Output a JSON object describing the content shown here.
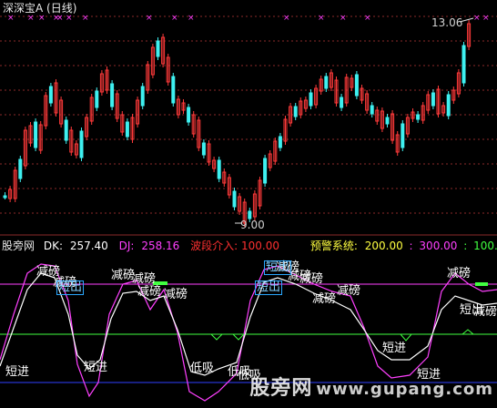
{
  "window": {
    "title": "深深宝A (日线)"
  },
  "main_chart": {
    "high_label": "13.06",
    "low_label": "9.00",
    "colors": {
      "up": "#ff3a3a",
      "down": "#3ef0f0",
      "grid": "#8b2a2a",
      "marker": "#ff40ff"
    }
  },
  "indicator": {
    "name": "股旁网",
    "dk_label": "DK:",
    "dk_value": "257.40",
    "dj_label": "DJ:",
    "dj_value": "258.16",
    "wave_label": "波段介入:",
    "wave_value": "100.00",
    "warn_label": "预警系统:",
    "warn_v1": "200.00",
    "sep": ":",
    "warn_v2": "300.00",
    "warn_v3": "100.00",
    "colors": {
      "name": "#e8e8e8",
      "dk": "#ffffff",
      "dj": "#ff40ff",
      "wave": "#ff3030",
      "warn": "#ffff40",
      "v1": "#ffff40",
      "v2": "#ff40ff",
      "v3": "#40ff40"
    },
    "signals": {
      "jianbang": "减磅",
      "duanjin": "短进",
      "dixi": "低吸",
      "duanchu": "短出",
      "jianbang_cut": "减磅"
    }
  },
  "watermark": {
    "text": "股旁网",
    "url": "www.gupang.com"
  }
}
